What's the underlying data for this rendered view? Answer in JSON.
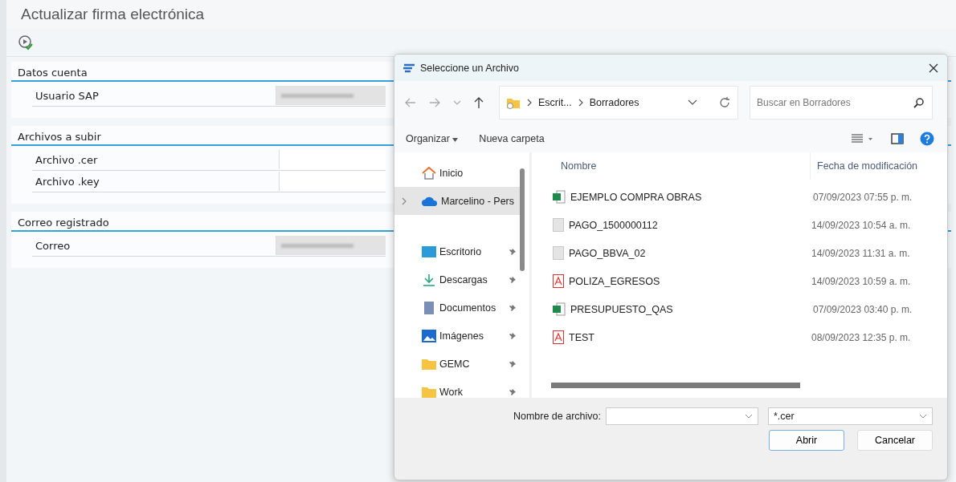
{
  "page": {
    "title": "Actualizar firma electrónica"
  },
  "sections": [
    {
      "title": "Datos cuenta",
      "fields": [
        {
          "label": "Usuario SAP",
          "kind": "redacted"
        }
      ]
    },
    {
      "title": "Archivos a subir",
      "fields": [
        {
          "label": "Archivo .cer",
          "kind": "empty"
        },
        {
          "label": "Archivo .key",
          "kind": "empty"
        }
      ]
    },
    {
      "title": "Correo registrado",
      "fields": [
        {
          "label": "Correo",
          "kind": "redacted"
        }
      ]
    }
  ],
  "dialog": {
    "title": "Seleccione un Archivo",
    "breadcrumb": [
      "Escrit...",
      "Borradores"
    ],
    "search": {
      "placeholder": "Buscar en Borradores"
    },
    "toolbar": [
      "Organizar",
      "Nueva carpeta"
    ],
    "sidebar": [
      {
        "label": "Inicio",
        "kind": "home",
        "pinned": false,
        "selected": false,
        "expandable": false
      },
      {
        "label": "Marcelino - Pers",
        "kind": "cloud",
        "pinned": false,
        "selected": true,
        "expandable": true
      },
      {
        "label": "Escritorio",
        "kind": "desktop",
        "pinned": true,
        "selected": false,
        "expandable": false
      },
      {
        "label": "Descargas",
        "kind": "download",
        "pinned": true,
        "selected": false,
        "expandable": false
      },
      {
        "label": "Documentos",
        "kind": "documents",
        "pinned": true,
        "selected": false,
        "expandable": false
      },
      {
        "label": "Imágenes",
        "kind": "images",
        "pinned": true,
        "selected": false,
        "expandable": false
      },
      {
        "label": "GEMC",
        "kind": "folder",
        "pinned": true,
        "selected": false,
        "expandable": false
      },
      {
        "label": "Work",
        "kind": "folder",
        "pinned": true,
        "selected": false,
        "expandable": false
      }
    ],
    "columns": [
      "Nombre",
      "Fecha de modificación"
    ],
    "files": [
      {
        "name": "EJEMPLO COMPRA OBRAS",
        "date": "07/09/2023 07:55 p. m.",
        "kind": "excel"
      },
      {
        "name": "PAGO_1500000112",
        "date": "14/09/2023 10:54 a. m.",
        "kind": "blank"
      },
      {
        "name": "PAGO_BBVA_02",
        "date": "14/09/2023 11:31 a. m.",
        "kind": "blank"
      },
      {
        "name": "POLIZA_EGRESOS",
        "date": "14/09/2023 10:59 a. m.",
        "kind": "pdf"
      },
      {
        "name": "PRESUPUESTO_QAS",
        "date": "07/09/2023 03:40 p. m.",
        "kind": "excel"
      },
      {
        "name": "TEST",
        "date": "08/09/2023 12:35 p. m.",
        "kind": "pdf"
      }
    ],
    "filename_label": "Nombre de archivo:",
    "filetype": "*.cer",
    "buttons": [
      "Abrir",
      "Cancelar"
    ]
  }
}
